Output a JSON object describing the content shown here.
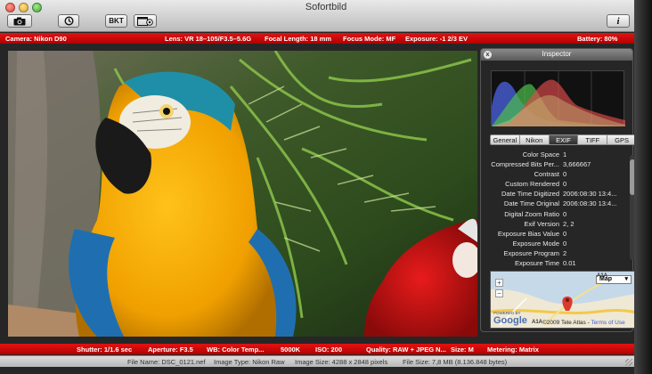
{
  "window": {
    "title": "Sofortbild"
  },
  "toolbar": {
    "bkt_label": "BKT",
    "info_label": "i"
  },
  "camera_bar": {
    "camera": "Camera: Nikon D90",
    "lens": "Lens: VR 18–105/F3.5–5.6G",
    "focal": "Focal Length: 18 mm",
    "focus": "Focus Mode: MF",
    "exposure": "Exposure: -1 2/3 EV",
    "battery": "Battery: 80%"
  },
  "settings_bar": {
    "shutter": "Shutter: 1/1.6 sec",
    "aperture": "Aperture: F3.5",
    "wb": "WB: Color Temp...",
    "kelvin": "5000K",
    "iso": "ISO: 200",
    "quality": "Quality: RAW + JPEG N...",
    "size": "Size: M",
    "metering": "Metering: Matrix"
  },
  "status": {
    "file_name": "File Name: DSC_0121.nef",
    "image_type": "Image Type: Nikon Raw",
    "image_size": "Image Size: 4288 x 2848 pixels",
    "file_size": "File Size: 7,8 MB (8.136.848 bytes)"
  },
  "inspector": {
    "title": "Inspector",
    "close_label": "x",
    "tabs": [
      {
        "label": "General",
        "active": false
      },
      {
        "label": "Nikon",
        "active": false
      },
      {
        "label": "EXIF",
        "active": true
      },
      {
        "label": "TIFF",
        "active": false
      },
      {
        "label": "GPS",
        "active": false
      }
    ],
    "exif": [
      {
        "key": "Color Space",
        "value": "1"
      },
      {
        "key": "Compressed Bits Per...",
        "value": "3,666667"
      },
      {
        "key": "Contrast",
        "value": "0"
      },
      {
        "key": "Custom Rendered",
        "value": "0"
      },
      {
        "key": "Date Time Digitized",
        "value": "2006:08:30 13:4..."
      },
      {
        "key": "Date Time Original",
        "value": "2006:08:30 13:4..."
      },
      {
        "key": "Digital Zoom Ratio",
        "value": "0"
      },
      {
        "key": "Exif Version",
        "value": "2, 2"
      },
      {
        "key": "Exposure Bias Value",
        "value": "0"
      },
      {
        "key": "Exposure Mode",
        "value": "0"
      },
      {
        "key": "Exposure Program",
        "value": "2"
      },
      {
        "key": "Exposure Time",
        "value": "0.01"
      }
    ],
    "map": {
      "type_label": "Map",
      "road_label": "A1A",
      "road_label2": "A1A",
      "zoom_in": "+",
      "zoom_out": "−",
      "powered": "POWERED BY",
      "logo": "Google",
      "copyright": "©2009 Tele Atlas -",
      "terms": "Terms of Use"
    }
  },
  "colors": {
    "accent_red": "#d40000",
    "histogram_red": "#e34b4b",
    "histogram_green": "#4bbf4b",
    "histogram_blue": "#4b63e3"
  }
}
